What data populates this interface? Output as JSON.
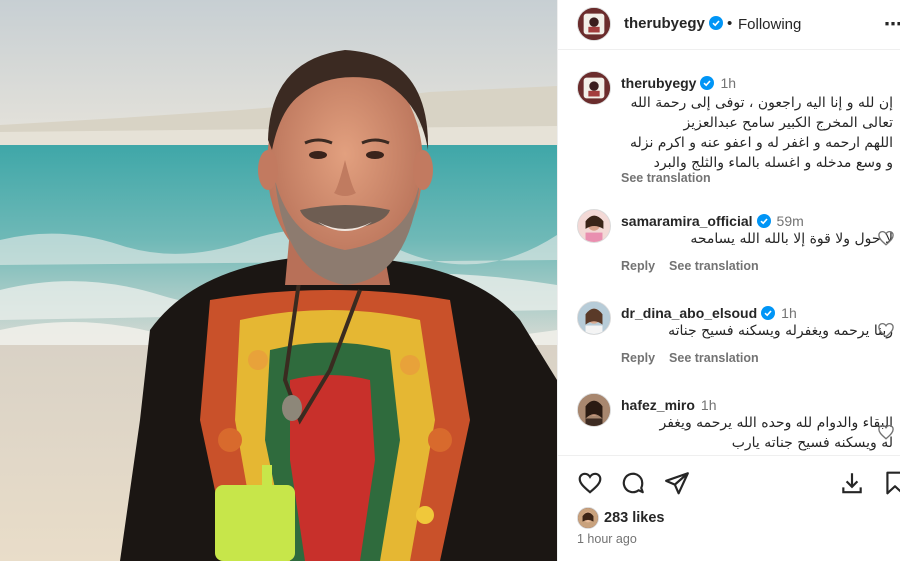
{
  "post": {
    "username": "therubyegy",
    "separator": "•",
    "follow_status": "Following",
    "more_label": "⋯"
  },
  "caption": {
    "username": "therubyegy",
    "time": "1h",
    "lines": [
      "إن لله و إنا اليه راجعون ، توفى إلى رحمة الله",
      "تعالى المخرج الكبير سامح عبدالعزيز",
      "اللهم ارحمه و اغفر له و اعفو عنه و اكرم نزله",
      "و وسع مدخله و اغسله بالماء والثلج والبرد"
    ],
    "see_translation": "See translation"
  },
  "comments": [
    {
      "username": "samaramira_official",
      "verified": true,
      "time": "59m",
      "text": "لا حول ولا قوة إلا بالله الله يسامحه",
      "reply": "Reply",
      "see_translation": "See translation",
      "avatar_color": "#e9c5c8"
    },
    {
      "username": "dr_dina_abo_elsoud",
      "verified": true,
      "time": "1h",
      "text": "ربنا يرحمه ويغفرله ويسكنه فسيح جناته",
      "reply": "Reply",
      "see_translation": "See translation",
      "avatar_color": "#9fb9c9"
    },
    {
      "username": "hafez_miro",
      "verified": false,
      "time": "1h",
      "text_lines": [
        "البقاء والدوام لله وحده الله يرحمه ويغفر",
        "له ويسكنه فسيح جناته يارب"
      ],
      "avatar_color": "#8a6a55"
    }
  ],
  "actions": {
    "icons": [
      "heart-icon",
      "comment-icon",
      "share-icon",
      "download-icon",
      "bookmark-icon"
    ]
  },
  "likes": {
    "text": "283 likes"
  },
  "posted_ago": "1 hour ago",
  "colors": {
    "verified_blue": "#0095f6",
    "secondary_text": "#737373",
    "primary_text": "#262626",
    "divider": "#efefef"
  }
}
